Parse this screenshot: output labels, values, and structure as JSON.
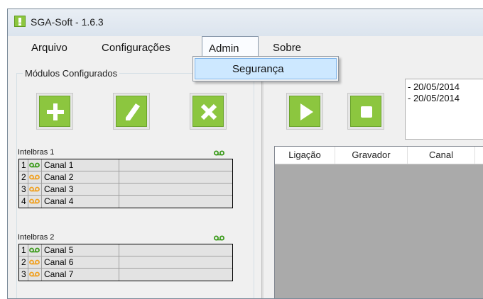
{
  "window": {
    "title": "SGA-Soft - 1.6.3",
    "app_icon": "exclamation-icon"
  },
  "menu": {
    "items": [
      {
        "label": "Arquivo"
      },
      {
        "label": "Configurações"
      },
      {
        "label": "Admin"
      },
      {
        "label": "Sobre"
      }
    ],
    "open_menu": "Admin",
    "dropdown": [
      {
        "label": "Segurança"
      }
    ]
  },
  "left_panel": {
    "title": "Módulos Configurados",
    "buttons": [
      {
        "icon": "plus-icon",
        "action": "add"
      },
      {
        "icon": "pencil-icon",
        "action": "edit"
      },
      {
        "icon": "x-icon",
        "action": "delete"
      }
    ],
    "modules": [
      {
        "name": "Intelbras 1",
        "status_icon": "recorder-icon",
        "channels": [
          {
            "num": "1",
            "label": "Canal 1",
            "status": "green"
          },
          {
            "num": "2",
            "label": "Canal 2",
            "status": "orange"
          },
          {
            "num": "3",
            "label": "Canal 3",
            "status": "orange"
          },
          {
            "num": "4",
            "label": "Canal 4",
            "status": "orange"
          }
        ]
      },
      {
        "name": "Intelbras 2",
        "status_icon": "recorder-icon",
        "channels": [
          {
            "num": "1",
            "label": "Canal 5",
            "status": "green"
          },
          {
            "num": "2",
            "label": "Canal 6",
            "status": "orange"
          },
          {
            "num": "3",
            "label": "Canal 7",
            "status": "orange"
          }
        ]
      }
    ]
  },
  "right_panel": {
    "buttons": [
      {
        "icon": "play-icon",
        "action": "start"
      },
      {
        "icon": "stop-icon",
        "action": "stop"
      }
    ],
    "log_lines": [
      "- 20/05/2014",
      "- 20/05/2014"
    ],
    "table": {
      "columns": [
        "Ligação",
        "Gravador",
        "Canal"
      ]
    }
  },
  "colors": {
    "accent_green": "#8cc63f",
    "status_green": "#3a9a1a",
    "status_orange": "#f0a020",
    "table_bg": "#aaaaaa"
  }
}
